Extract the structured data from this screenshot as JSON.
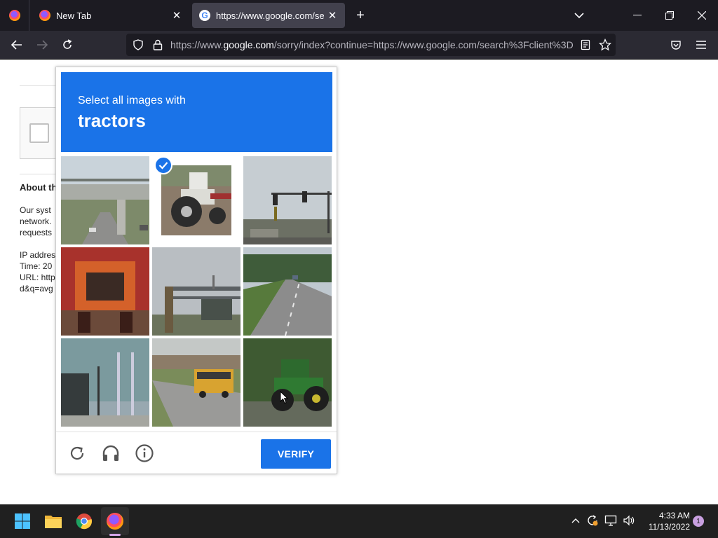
{
  "browser": {
    "tabs": [
      {
        "label": "New Tab",
        "icon": "firefox-icon",
        "active": false
      },
      {
        "label": "https://www.google.com/searc",
        "icon": "google-icon",
        "active": true
      }
    ],
    "url": {
      "prefix": "https://www.",
      "domain": "google.com",
      "rest": "/sorry/index?continue=https://www.google.com/search%3Fclient%3D"
    }
  },
  "page": {
    "about_heading": "About th",
    "lines": [
      "Our syst",
      "network.",
      "requests",
      "IP addres",
      "Time: 20",
      "URL: http",
      "d&q=avg"
    ]
  },
  "captcha": {
    "instruction": "Select all images with",
    "object": "tractors",
    "tiles": [
      {
        "content": "highway overpass",
        "selected": false
      },
      {
        "content": "white tractor",
        "selected": true
      },
      {
        "content": "traffic lights",
        "selected": false
      },
      {
        "content": "orange tractor",
        "selected": false
      },
      {
        "content": "highway sign",
        "selected": false
      },
      {
        "content": "road",
        "selected": false
      },
      {
        "content": "building",
        "selected": false
      },
      {
        "content": "school bus",
        "selected": false
      },
      {
        "content": "green tractor",
        "selected": false
      }
    ],
    "verify_label": "VERIFY",
    "footer_icons": [
      "reload-icon",
      "headphones-icon",
      "info-icon"
    ],
    "accent": "#1a73e8"
  },
  "taskbar": {
    "apps": [
      "windows-start-icon",
      "file-explorer-icon",
      "chrome-icon",
      "firefox-icon"
    ],
    "time": "4:33 AM",
    "date": "11/13/2022",
    "notifications": "1"
  }
}
